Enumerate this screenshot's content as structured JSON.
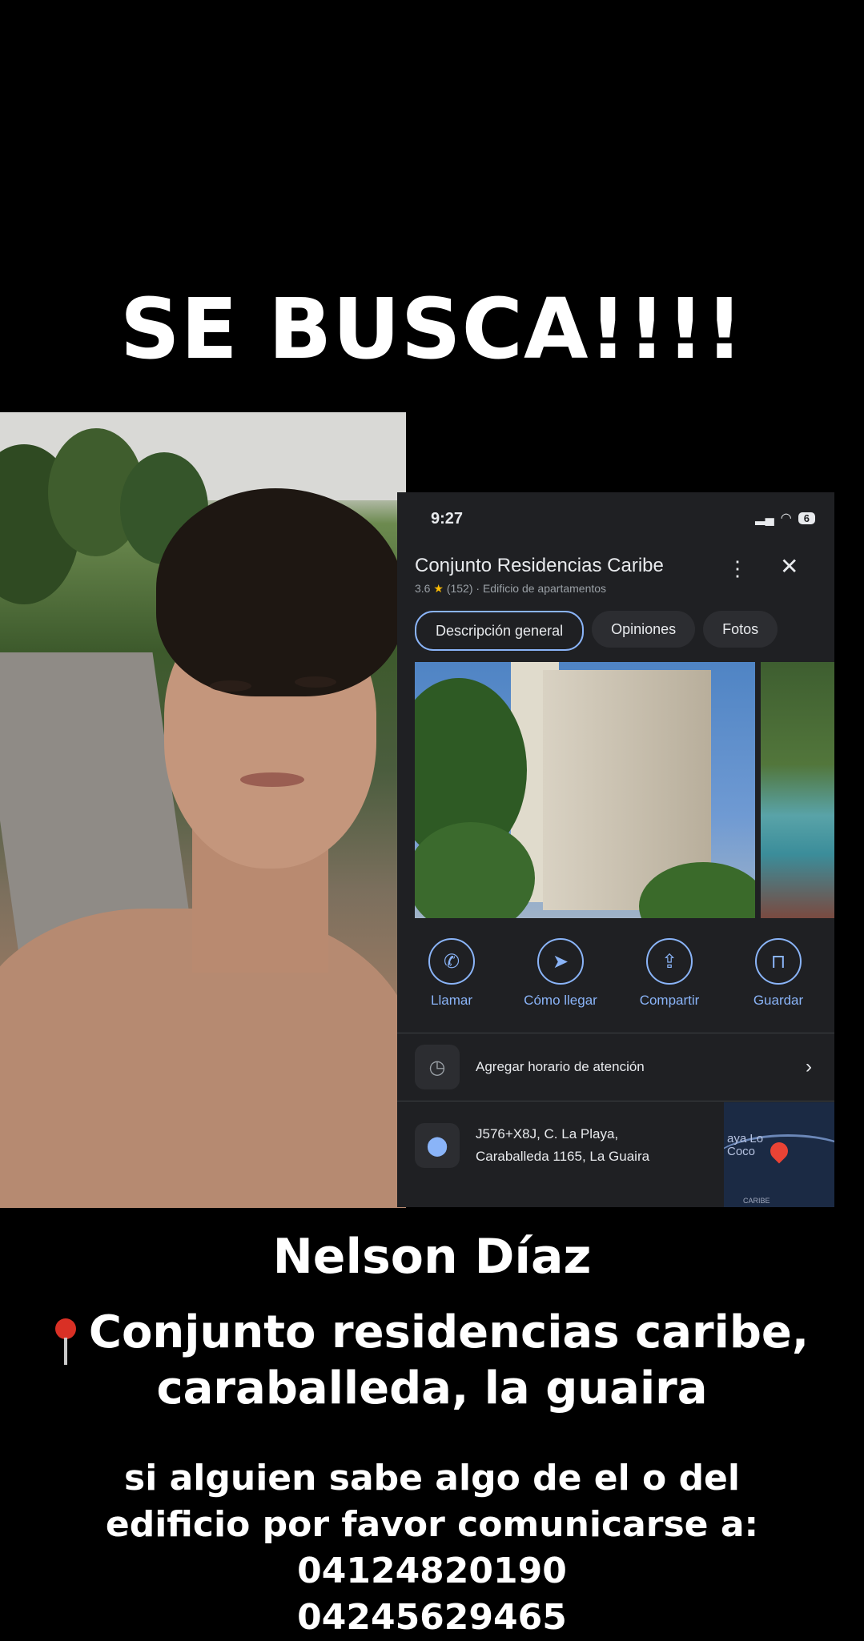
{
  "headline": "SE BUSCA!!!!",
  "maps": {
    "time": "9:27",
    "battery": "6",
    "title": "Conjunto Residencias Caribe",
    "rating": "3.6",
    "reviews": "(152)",
    "category": "Edificio de apartamentos",
    "tabs": [
      "Descripción general",
      "Opiniones",
      "Fotos"
    ],
    "actions": [
      "Llamar",
      "Cómo llegar",
      "Compartir",
      "Guardar"
    ],
    "hours_label": "Agregar horario de atención",
    "address_line1": "J576+X8J, C. La Playa,",
    "address_line2": "Caraballeda 1165, La Guaira",
    "map_label_1": "aya Lo",
    "map_label_2": "Coco",
    "map_small": "CARIBE"
  },
  "poster": {
    "name": "Nelson Díaz",
    "location_line1": "Conjunto residencias caribe,",
    "location_line2": "caraballeda, la guaira",
    "message_line1": "si alguien sabe algo de el o del",
    "message_line2": "edificio por favor comunicarse a:",
    "phone1": "04124820190",
    "phone2": "04245629465"
  }
}
